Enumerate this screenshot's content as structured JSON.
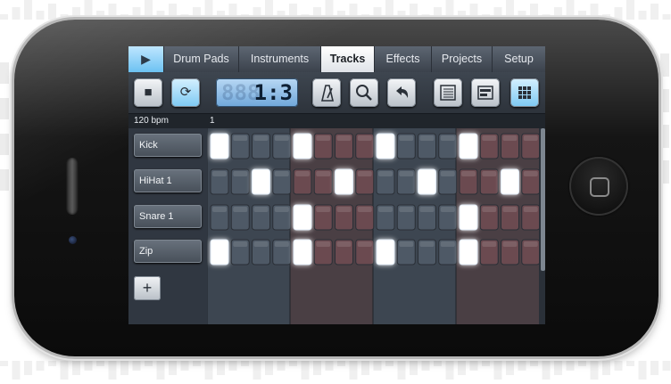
{
  "tabs": {
    "play_icon": "▶",
    "drum_pads": "Drum Pads",
    "instruments": "Instruments",
    "tracks": "Tracks",
    "effects": "Effects",
    "projects": "Projects",
    "setup": "Setup"
  },
  "toolbar": {
    "stop_icon": "■",
    "loop_icon": "⟳",
    "lcd_value": "1:3",
    "lcd_ghost": "888",
    "metronome_icon": "metronome-icon",
    "zoom_icon": "⌕",
    "undo_icon": "↶",
    "list_icon": "list-icon",
    "mixer_icon": "panel-icon",
    "grid_icon": "grid-icon"
  },
  "ruler": {
    "bpm": "120 bpm",
    "bar": "1"
  },
  "tracks": [
    {
      "name": "Kick",
      "steps": [
        1,
        0,
        0,
        0,
        1,
        0,
        0,
        0,
        1,
        0,
        0,
        0,
        1,
        0,
        0,
        0
      ]
    },
    {
      "name": "HiHat 1",
      "steps": [
        0,
        0,
        1,
        0,
        0,
        0,
        1,
        0,
        0,
        0,
        1,
        0,
        0,
        0,
        1,
        0
      ]
    },
    {
      "name": "Snare 1",
      "steps": [
        0,
        0,
        0,
        0,
        1,
        0,
        0,
        0,
        0,
        0,
        0,
        0,
        1,
        0,
        0,
        0
      ]
    },
    {
      "name": "Zip",
      "steps": [
        1,
        0,
        0,
        0,
        1,
        0,
        0,
        0,
        1,
        0,
        0,
        0,
        1,
        0,
        0,
        0
      ]
    }
  ],
  "add_track": "+",
  "colors": {
    "step_blue": "#4e5966",
    "step_red": "#6b4a50",
    "step_on": "#ffffff",
    "accent": "#7cc9f3"
  }
}
